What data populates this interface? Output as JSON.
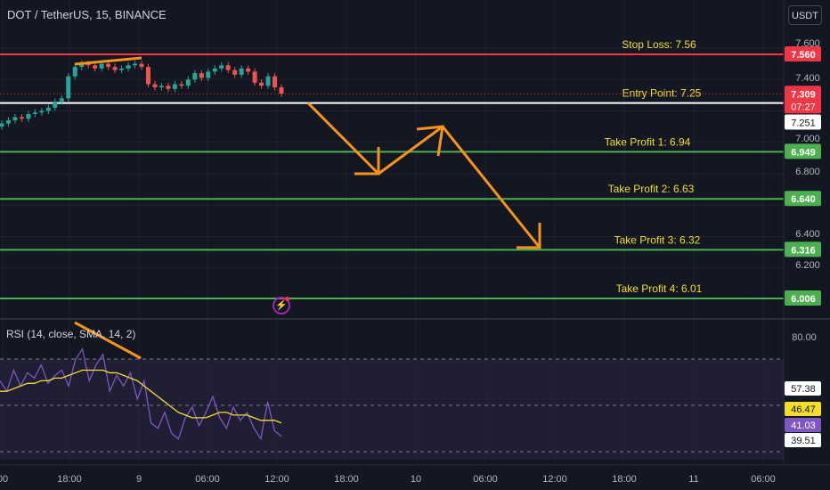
{
  "header": {
    "symbol": "DOT / TetherUS, 15, BINANCE",
    "currency_button": "USDT"
  },
  "colors": {
    "background": "#131722",
    "stop_loss": "#f23645",
    "entry": "#ffffff",
    "take_profit": "#4caf50",
    "annotation_text": "#f5dd2b",
    "arrow": "#f7931a",
    "candle_up": "#26a69a",
    "candle_down": "#ef5350",
    "rsi_line": "#7e57c2",
    "rsi_ma": "#f5dd2b",
    "rsi_band": "#2a2440"
  },
  "levels": [
    {
      "label": "Stop Loss: 7.56",
      "price": 7.56,
      "tag": "7.560",
      "kind": "stop"
    },
    {
      "label": "Entry Point: 7.25",
      "price": 7.25,
      "tag": "",
      "kind": "entry"
    },
    {
      "label": "Take Profit 1: 6.94",
      "price": 6.94,
      "tag": "6.949",
      "kind": "tp"
    },
    {
      "label": "Take Profit 2: 6.63",
      "price": 6.64,
      "tag": "6.640",
      "kind": "tp"
    },
    {
      "label": "Take Profit 3: 6.32",
      "price": 6.316,
      "tag": "6.316",
      "kind": "tp"
    },
    {
      "label": "Take Profit 4: 6.01",
      "price": 6.006,
      "tag": "6.006",
      "kind": "tp"
    }
  ],
  "price_tags": {
    "last_price": "7.309",
    "countdown": "07:27",
    "pre_entry": "7.251"
  },
  "rsi": {
    "label": "RSI (14, close, SMA, 14, 2)",
    "value": "41.03",
    "ma_value": "46.47",
    "tag_upper": "57.38",
    "tag_lower": "39.51"
  },
  "chart_data": [
    {
      "type": "line",
      "title": "DOT / TetherUS, 15, BINANCE",
      "y_axis_ticks": [
        "7.600",
        "7.400",
        "7.251",
        "7.000",
        "6.800",
        "6.400",
        "6.200"
      ],
      "x_axis_ticks": [
        "00",
        "18:00",
        "9",
        "06:00",
        "12:00",
        "18:00",
        "10",
        "06:00",
        "12:00",
        "18:00",
        "11",
        "06:00"
      ],
      "ylim": [
        5.95,
        7.7
      ],
      "series": [
        {
          "values": [
            7.12,
            7.14,
            7.16,
            7.15,
            7.18,
            7.19,
            7.2,
            7.22,
            7.26,
            7.28,
            7.42,
            7.48,
            7.5,
            7.49,
            7.47,
            7.5,
            7.48,
            7.46,
            7.47,
            7.49,
            7.5,
            7.48,
            7.37,
            7.35,
            7.36,
            7.34,
            7.37,
            7.36,
            7.4,
            7.44,
            7.41,
            7.45,
            7.47,
            7.49,
            7.46,
            7.43,
            7.47,
            7.45,
            7.38,
            7.36,
            7.42,
            7.35,
            7.31
          ]
        }
      ],
      "projected_path": [
        7.25,
        6.8,
        7.1,
        6.33
      ]
    },
    {
      "type": "line",
      "title": "RSI (14, close, SMA, 14, 2)",
      "y_axis_ticks": [
        "80.00",
        "57.38",
        "46.47",
        "41.03",
        "39.51"
      ],
      "ylim": [
        30,
        85
      ],
      "series": [
        {
          "values": [
            62,
            58,
            66,
            60,
            65,
            63,
            68,
            61,
            64,
            66,
            60,
            70,
            74,
            62,
            68,
            72,
            58,
            64,
            60,
            65,
            55,
            62,
            46,
            44,
            50,
            42,
            40,
            48,
            52,
            45,
            50,
            56,
            48,
            44,
            52,
            47,
            50,
            44,
            40,
            54,
            43,
            41
          ]
        },
        {
          "values": [
            58,
            58,
            59,
            60,
            61,
            61,
            62,
            62,
            63,
            63,
            64,
            65,
            66,
            66,
            66,
            66,
            65,
            65,
            64,
            63,
            62,
            60,
            58,
            56,
            54,
            52,
            50,
            49,
            48,
            48,
            48,
            49,
            50,
            50,
            49,
            49,
            49,
            48,
            47,
            47,
            47,
            46
          ]
        }
      ]
    }
  ]
}
